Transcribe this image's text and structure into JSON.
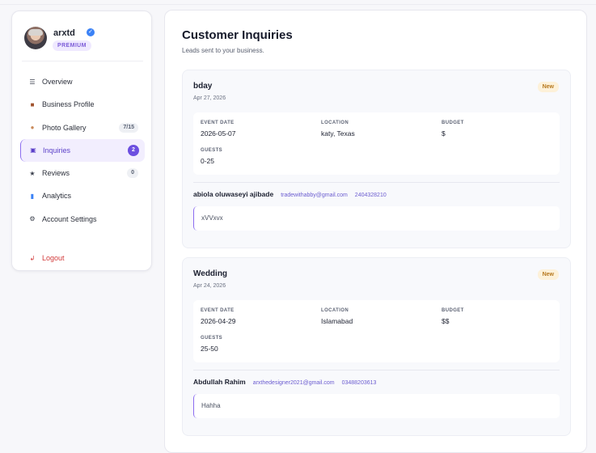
{
  "profile": {
    "username": "arxtd",
    "badge": "PREMIUM"
  },
  "nav": {
    "items": [
      {
        "label": "Overview",
        "icon": "list-icon"
      },
      {
        "label": "Business Profile",
        "icon": "briefcase-icon"
      },
      {
        "label": "Photo Gallery",
        "icon": "gallery-icon",
        "badge": "7/15"
      },
      {
        "label": "Inquiries",
        "icon": "inbox-icon",
        "badge": "2"
      },
      {
        "label": "Reviews",
        "icon": "star-icon",
        "badge": "0"
      },
      {
        "label": "Analytics",
        "icon": "chart-icon"
      },
      {
        "label": "Account Settings",
        "icon": "gear-icon"
      }
    ],
    "logout": "Logout"
  },
  "main": {
    "title": "Customer Inquiries",
    "subtitle": "Leads sent to your business."
  },
  "inquiries": [
    {
      "title": "bday",
      "date": "Apr 27, 2026",
      "status": "New",
      "labels": {
        "event_date": "EVENT DATE",
        "location": "LOCATION",
        "budget": "BUDGET",
        "guests": "GUESTS"
      },
      "event_date": "2026-05-07",
      "location": "katy, Texas",
      "budget": "$",
      "guests": "0-25",
      "name": "abiola oluwaseyi ajibade",
      "email": "tradewithabby@gmail.com",
      "phone": "2404328210",
      "message": "xVVxvx"
    },
    {
      "title": "Wedding",
      "date": "Apr 24, 2026",
      "status": "New",
      "labels": {
        "event_date": "EVENT DATE",
        "location": "LOCATION",
        "budget": "BUDGET",
        "guests": "GUESTS"
      },
      "event_date": "2026-04-29",
      "location": "Islamabad",
      "budget": "$$",
      "guests": "25-50",
      "name": "Abdullah Rahim",
      "email": "arxthedesigner2021@gmail.com",
      "phone": "03488203613",
      "message": "Hahha"
    }
  ],
  "colors": {
    "accent": "#6c4fe0",
    "logout": "#d23b3b",
    "new_badge": "#b7791f"
  }
}
